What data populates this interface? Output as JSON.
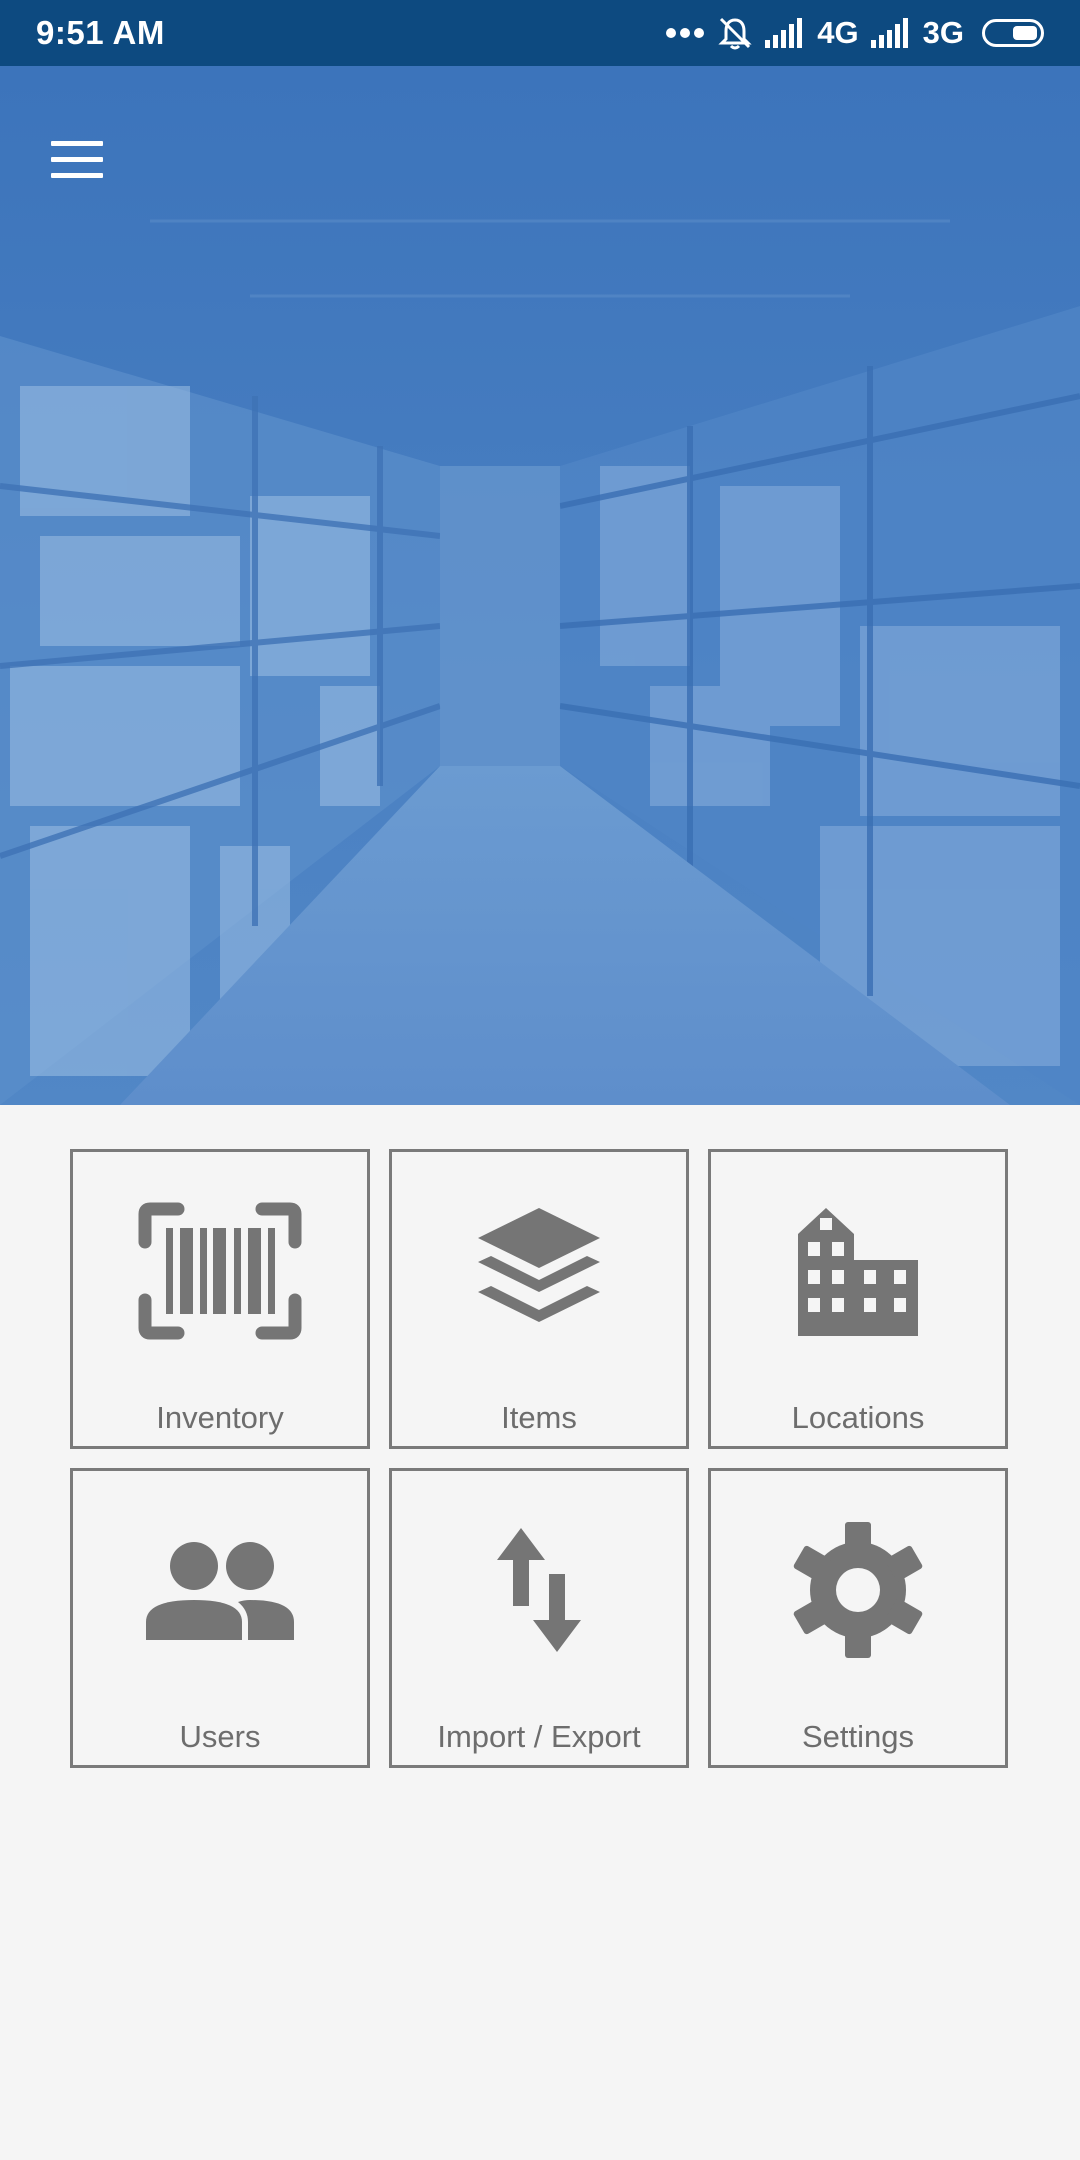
{
  "status_bar": {
    "time": "9:51 AM",
    "network_1": "4G",
    "network_2": "3G"
  },
  "header": {
    "menu_icon": "hamburger-menu-icon",
    "hero_image": "warehouse-aisle-photo",
    "overlay_color": "#3d76bd"
  },
  "tiles": [
    {
      "label": "Inventory",
      "icon": "barcode-scan-icon"
    },
    {
      "label": "Items",
      "icon": "layers-icon"
    },
    {
      "label": "Locations",
      "icon": "building-icon"
    },
    {
      "label": "Users",
      "icon": "people-icon"
    },
    {
      "label": "Import / Export",
      "icon": "swap-vertical-icon"
    },
    {
      "label": "Settings",
      "icon": "gear-icon"
    }
  ],
  "colors": {
    "status_bar": "#0d4a80",
    "tile_border": "#7a7a7a",
    "icon_gray": "#757575",
    "background": "#f5f5f5"
  }
}
